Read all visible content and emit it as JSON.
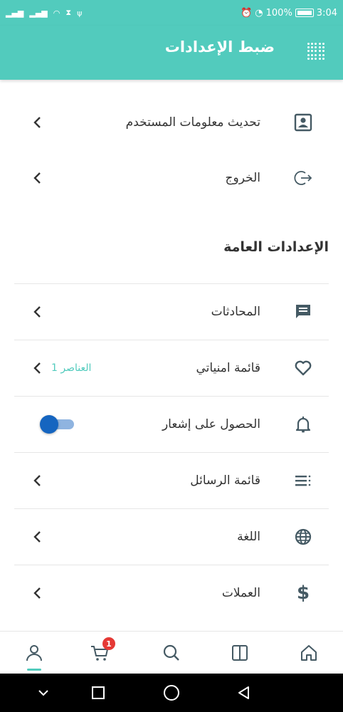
{
  "status_bar": {
    "left": "3G 3G",
    "battery": "100%",
    "time": "3:04"
  },
  "app_bar": {
    "title": "ضبط الإعدادات",
    "menu_icon": "dots-grid-icon"
  },
  "account_items": [
    {
      "label": "تحديث معلومات المستخدم",
      "icon": "user-profile-icon"
    },
    {
      "label": "الخروج",
      "icon": "logout-icon"
    }
  ],
  "general_section": {
    "title": "الإعدادات العامة",
    "items": [
      {
        "label": "المحادثات",
        "icon": "chat-icon"
      },
      {
        "label": "قائمة امنياتي",
        "icon": "heart-icon",
        "badge": "1 العناصر"
      },
      {
        "label": "الحصول على إشعار",
        "icon": "bell-icon",
        "toggle_on": true
      },
      {
        "label": "قائمة الرسائل",
        "icon": "message-list-icon"
      },
      {
        "label": "اللغة",
        "icon": "globe-icon"
      },
      {
        "label": "العملات",
        "icon": "dollar-icon"
      }
    ]
  },
  "bottom_nav": {
    "cart_count": "1",
    "items": [
      "profile-icon",
      "cart-icon",
      "search-icon",
      "book-icon",
      "home-icon"
    ],
    "active": "profile-icon"
  },
  "colors": {
    "accent": "#52cbbd",
    "toggle": "#1565c0",
    "badge": "#e53935"
  }
}
